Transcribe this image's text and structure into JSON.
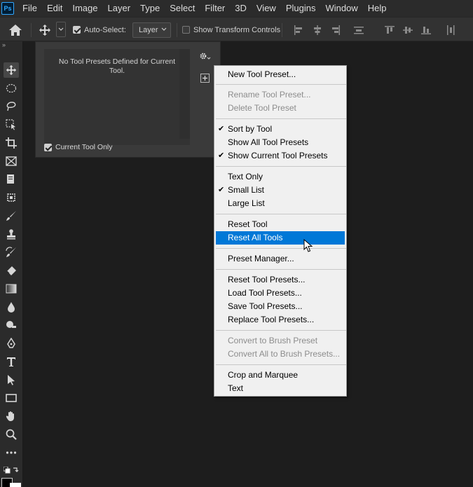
{
  "app": {
    "logo_text": "Ps"
  },
  "menubar": {
    "items": [
      "File",
      "Edit",
      "Image",
      "Layer",
      "Type",
      "Select",
      "Filter",
      "3D",
      "View",
      "Plugins",
      "Window",
      "Help"
    ]
  },
  "options_bar": {
    "auto_select_label": "Auto-Select:",
    "auto_select_checked": true,
    "layer_select_value": "Layer",
    "show_transform_label": "Show Transform Controls",
    "show_transform_checked": false
  },
  "toolbar": {
    "header": "»"
  },
  "tool_presets_panel": {
    "empty_message": "No Tool Presets Defined for Current Tool.",
    "current_tool_only_label": "Current Tool Only",
    "current_tool_only_checked": true
  },
  "context_menu": {
    "items": [
      {
        "label": "New Tool Preset...",
        "enabled": true,
        "checked": false
      },
      {
        "label": "Rename Tool Preset...",
        "enabled": false,
        "checked": false
      },
      {
        "label": "Delete Tool Preset",
        "enabled": false,
        "checked": false
      },
      {
        "label": "Sort by Tool",
        "enabled": true,
        "checked": true
      },
      {
        "label": "Show All Tool Presets",
        "enabled": true,
        "checked": false
      },
      {
        "label": "Show Current Tool Presets",
        "enabled": true,
        "checked": true
      },
      {
        "label": "Text Only",
        "enabled": true,
        "checked": false
      },
      {
        "label": "Small List",
        "enabled": true,
        "checked": true
      },
      {
        "label": "Large List",
        "enabled": true,
        "checked": false
      },
      {
        "label": "Reset Tool",
        "enabled": true,
        "checked": false
      },
      {
        "label": "Reset All Tools",
        "enabled": true,
        "checked": false,
        "highlighted": true
      },
      {
        "label": "Preset Manager...",
        "enabled": true,
        "checked": false
      },
      {
        "label": "Reset Tool Presets...",
        "enabled": true,
        "checked": false
      },
      {
        "label": "Load Tool Presets...",
        "enabled": true,
        "checked": false
      },
      {
        "label": "Save Tool Presets...",
        "enabled": true,
        "checked": false
      },
      {
        "label": "Replace Tool Presets...",
        "enabled": true,
        "checked": false
      },
      {
        "label": "Convert to Brush Preset",
        "enabled": false,
        "checked": false
      },
      {
        "label": "Convert All to Brush Presets...",
        "enabled": false,
        "checked": false
      },
      {
        "label": "Crop and Marquee",
        "enabled": true,
        "checked": false
      },
      {
        "label": "Text",
        "enabled": true,
        "checked": false
      }
    ]
  },
  "colors": {
    "highlight": "#0078d7",
    "background": "#1d1d1d"
  }
}
